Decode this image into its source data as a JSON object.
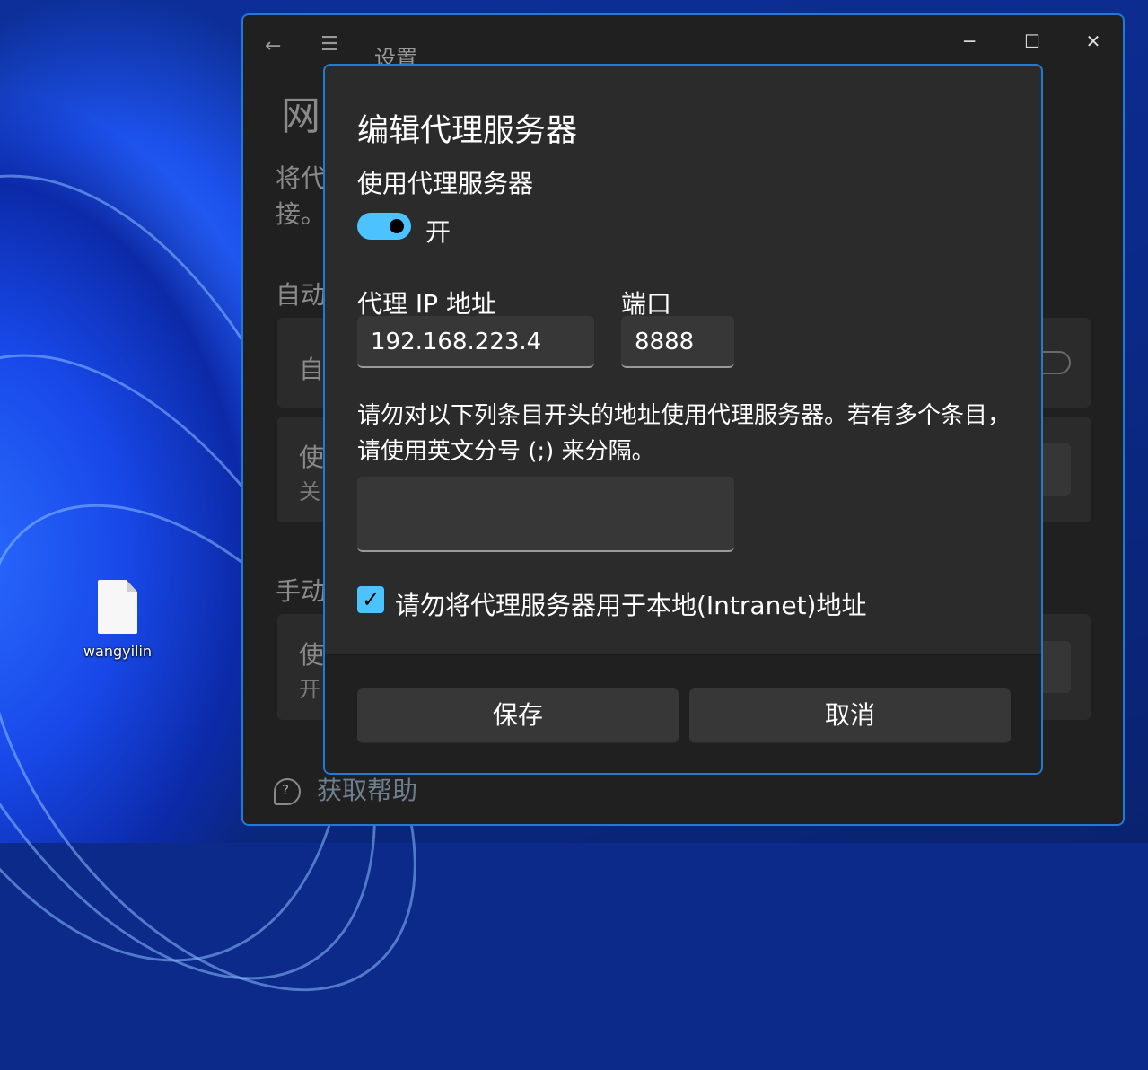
{
  "desktop": {
    "icon_label": "wangyilin"
  },
  "settings_window": {
    "app_title": "设置",
    "page_title": "网",
    "description": "将代 接。",
    "section_auto": "自动",
    "auto_card_label": "自",
    "script_card_label": "使",
    "script_card_sub": "关",
    "section_manual": "手动",
    "manual_card_label": "使",
    "manual_card_sub": "开",
    "help_label": "获取帮助",
    "minimize_icon": "─",
    "maximize_icon": "☐",
    "close_icon": "✕",
    "back_icon": "←",
    "menu_icon": "☰"
  },
  "dialog": {
    "title": "编辑代理服务器",
    "use_proxy_label": "使用代理服务器",
    "toggle_state": "开",
    "ip_label": "代理 IP 地址",
    "ip_value": "192.168.223.4",
    "port_label": "端口",
    "port_value": "8888",
    "exceptions_note": "请勿对以下列条目开头的地址使用代理服务器。若有多个条目，请使用英文分号 (;) 来分隔。",
    "exceptions_value": "",
    "local_checkbox_label": "请勿将代理服务器用于本地(Intranet)地址",
    "local_checkbox_checked": true,
    "save_label": "保存",
    "cancel_label": "取消"
  },
  "colors": {
    "accent": "#4cc2ff",
    "window_border": "#1f7ad8",
    "dialog_bg": "#2b2b2b",
    "window_bg": "#202020"
  }
}
